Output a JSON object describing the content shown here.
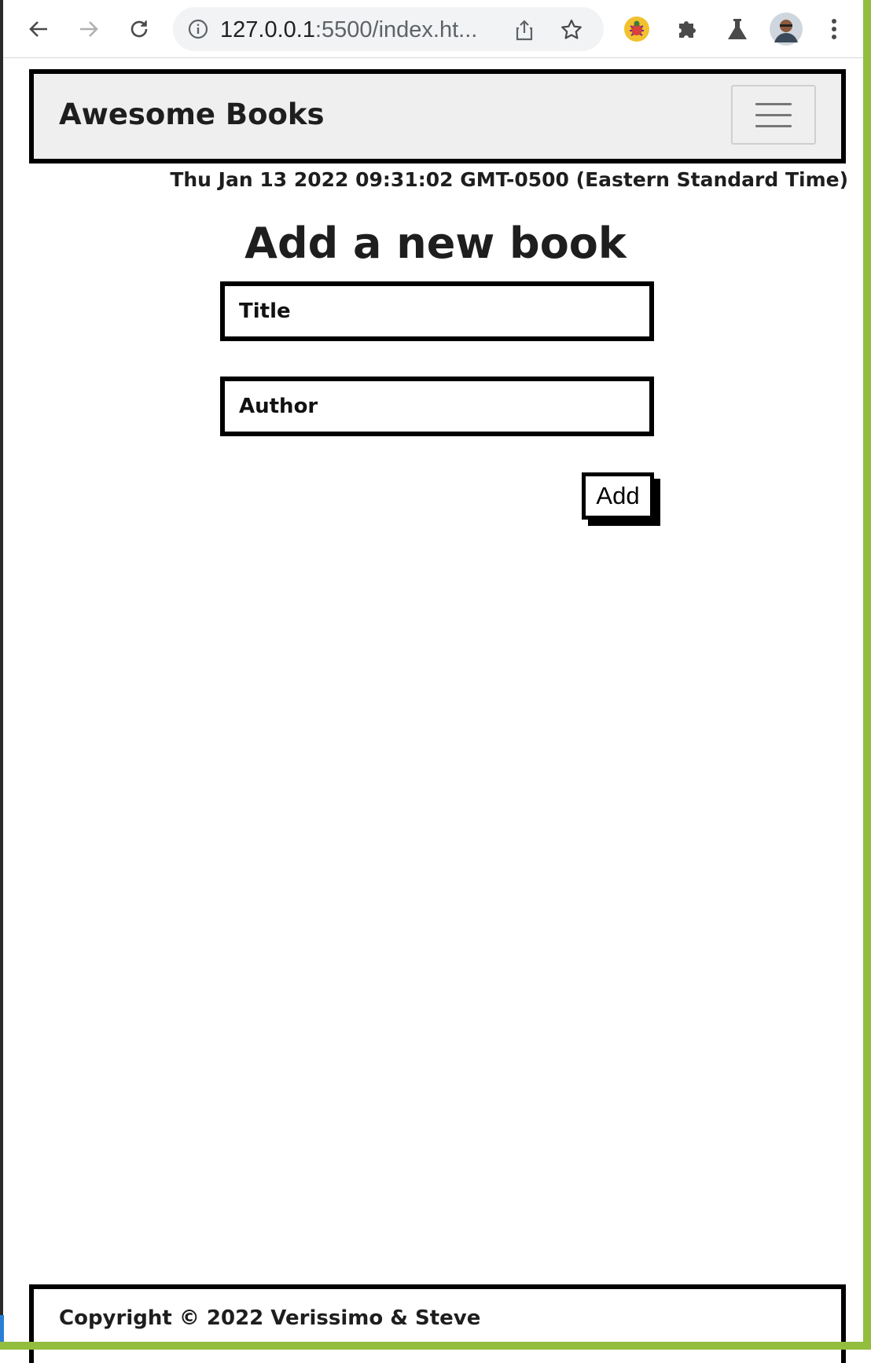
{
  "browser": {
    "url_host": "127.0.0.1",
    "url_rest": ":5500/index.ht...",
    "icons": [
      "back-icon",
      "forward-icon",
      "reload-icon",
      "info-icon",
      "share-icon",
      "star-icon",
      "extension-bug-icon",
      "puzzle-icon",
      "labs-flask-icon",
      "profile-avatar",
      "menu-dots-icon"
    ]
  },
  "navbar": {
    "brand": "Awesome Books",
    "menu_icon": "hamburger-icon"
  },
  "date_text": "Thu Jan 13 2022 09:31:02 GMT-0500 (Eastern Standard Time)",
  "form": {
    "heading": "Add a new book",
    "title_placeholder": "Title",
    "author_placeholder": "Author",
    "add_label": "Add"
  },
  "footer": {
    "text": "Copyright © 2022 Verissimo & Steve"
  },
  "colors": {
    "accent_green": "#93bd3e",
    "navbar_bg": "#efefef",
    "border": "#000000"
  }
}
